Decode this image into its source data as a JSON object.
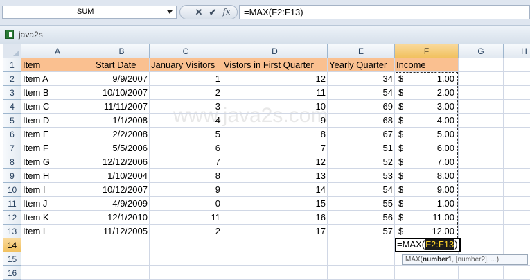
{
  "formula_bar": {
    "name_box": "SUM",
    "cancel_glyph": "✕",
    "enter_glyph": "✔",
    "fx_glyph": "fx",
    "formula": "=MAX(F2:F13)"
  },
  "window": {
    "title": "java2s",
    "icon": "excel-workbook-icon"
  },
  "watermark": "www.java2s.com",
  "columns": [
    "A",
    "B",
    "C",
    "D",
    "E",
    "F",
    "G",
    "H"
  ],
  "rows": [
    [
      "Item",
      "Start Date",
      "January Visitors",
      "Vistors in First Quarter",
      "Yearly Quarter",
      "Income"
    ],
    [
      "Item A",
      "9/9/2007",
      "1",
      "12",
      "34",
      "$",
      "1.00"
    ],
    [
      "Item B",
      "10/10/2007",
      "2",
      "11",
      "54",
      "$",
      "2.00"
    ],
    [
      "Item C",
      "11/11/2007",
      "3",
      "10",
      "69",
      "$",
      "3.00"
    ],
    [
      "Item D",
      "1/1/2008",
      "4",
      "9",
      "68",
      "$",
      "4.00"
    ],
    [
      "Item E",
      "2/2/2008",
      "5",
      "8",
      "67",
      "$",
      "5.00"
    ],
    [
      "Item F",
      "5/5/2006",
      "6",
      "7",
      "51",
      "$",
      "6.00"
    ],
    [
      "Item G",
      "12/12/2006",
      "7",
      "12",
      "52",
      "$",
      "7.00"
    ],
    [
      "Item H",
      "1/10/2004",
      "8",
      "13",
      "53",
      "$",
      "8.00"
    ],
    [
      "Item I",
      "10/12/2007",
      "9",
      "14",
      "54",
      "$",
      "9.00"
    ],
    [
      "Item J",
      "4/9/2009",
      "0",
      "15",
      "55",
      "$",
      "1.00"
    ],
    [
      "Item K",
      "12/1/2010",
      "11",
      "16",
      "56",
      "$",
      "11.00"
    ],
    [
      "Item L",
      "11/12/2005",
      "2",
      "17",
      "57",
      "$",
      "12.00"
    ]
  ],
  "row_numbers": [
    "1",
    "2",
    "3",
    "4",
    "5",
    "6",
    "7",
    "8",
    "9",
    "10",
    "11",
    "12",
    "13",
    "14",
    "15",
    "16"
  ],
  "editing_cell": {
    "prefix": "=MAX(",
    "ref": "F2:F13",
    "suffix": ")"
  },
  "tooltip": {
    "fn": "MAX(",
    "arg1": "number1",
    "rest": ", [number2], ...)"
  },
  "colors": {
    "header_fill": "#fac090",
    "selected_header": "#f1c15f",
    "ref_highlight": "#ffd42a"
  }
}
